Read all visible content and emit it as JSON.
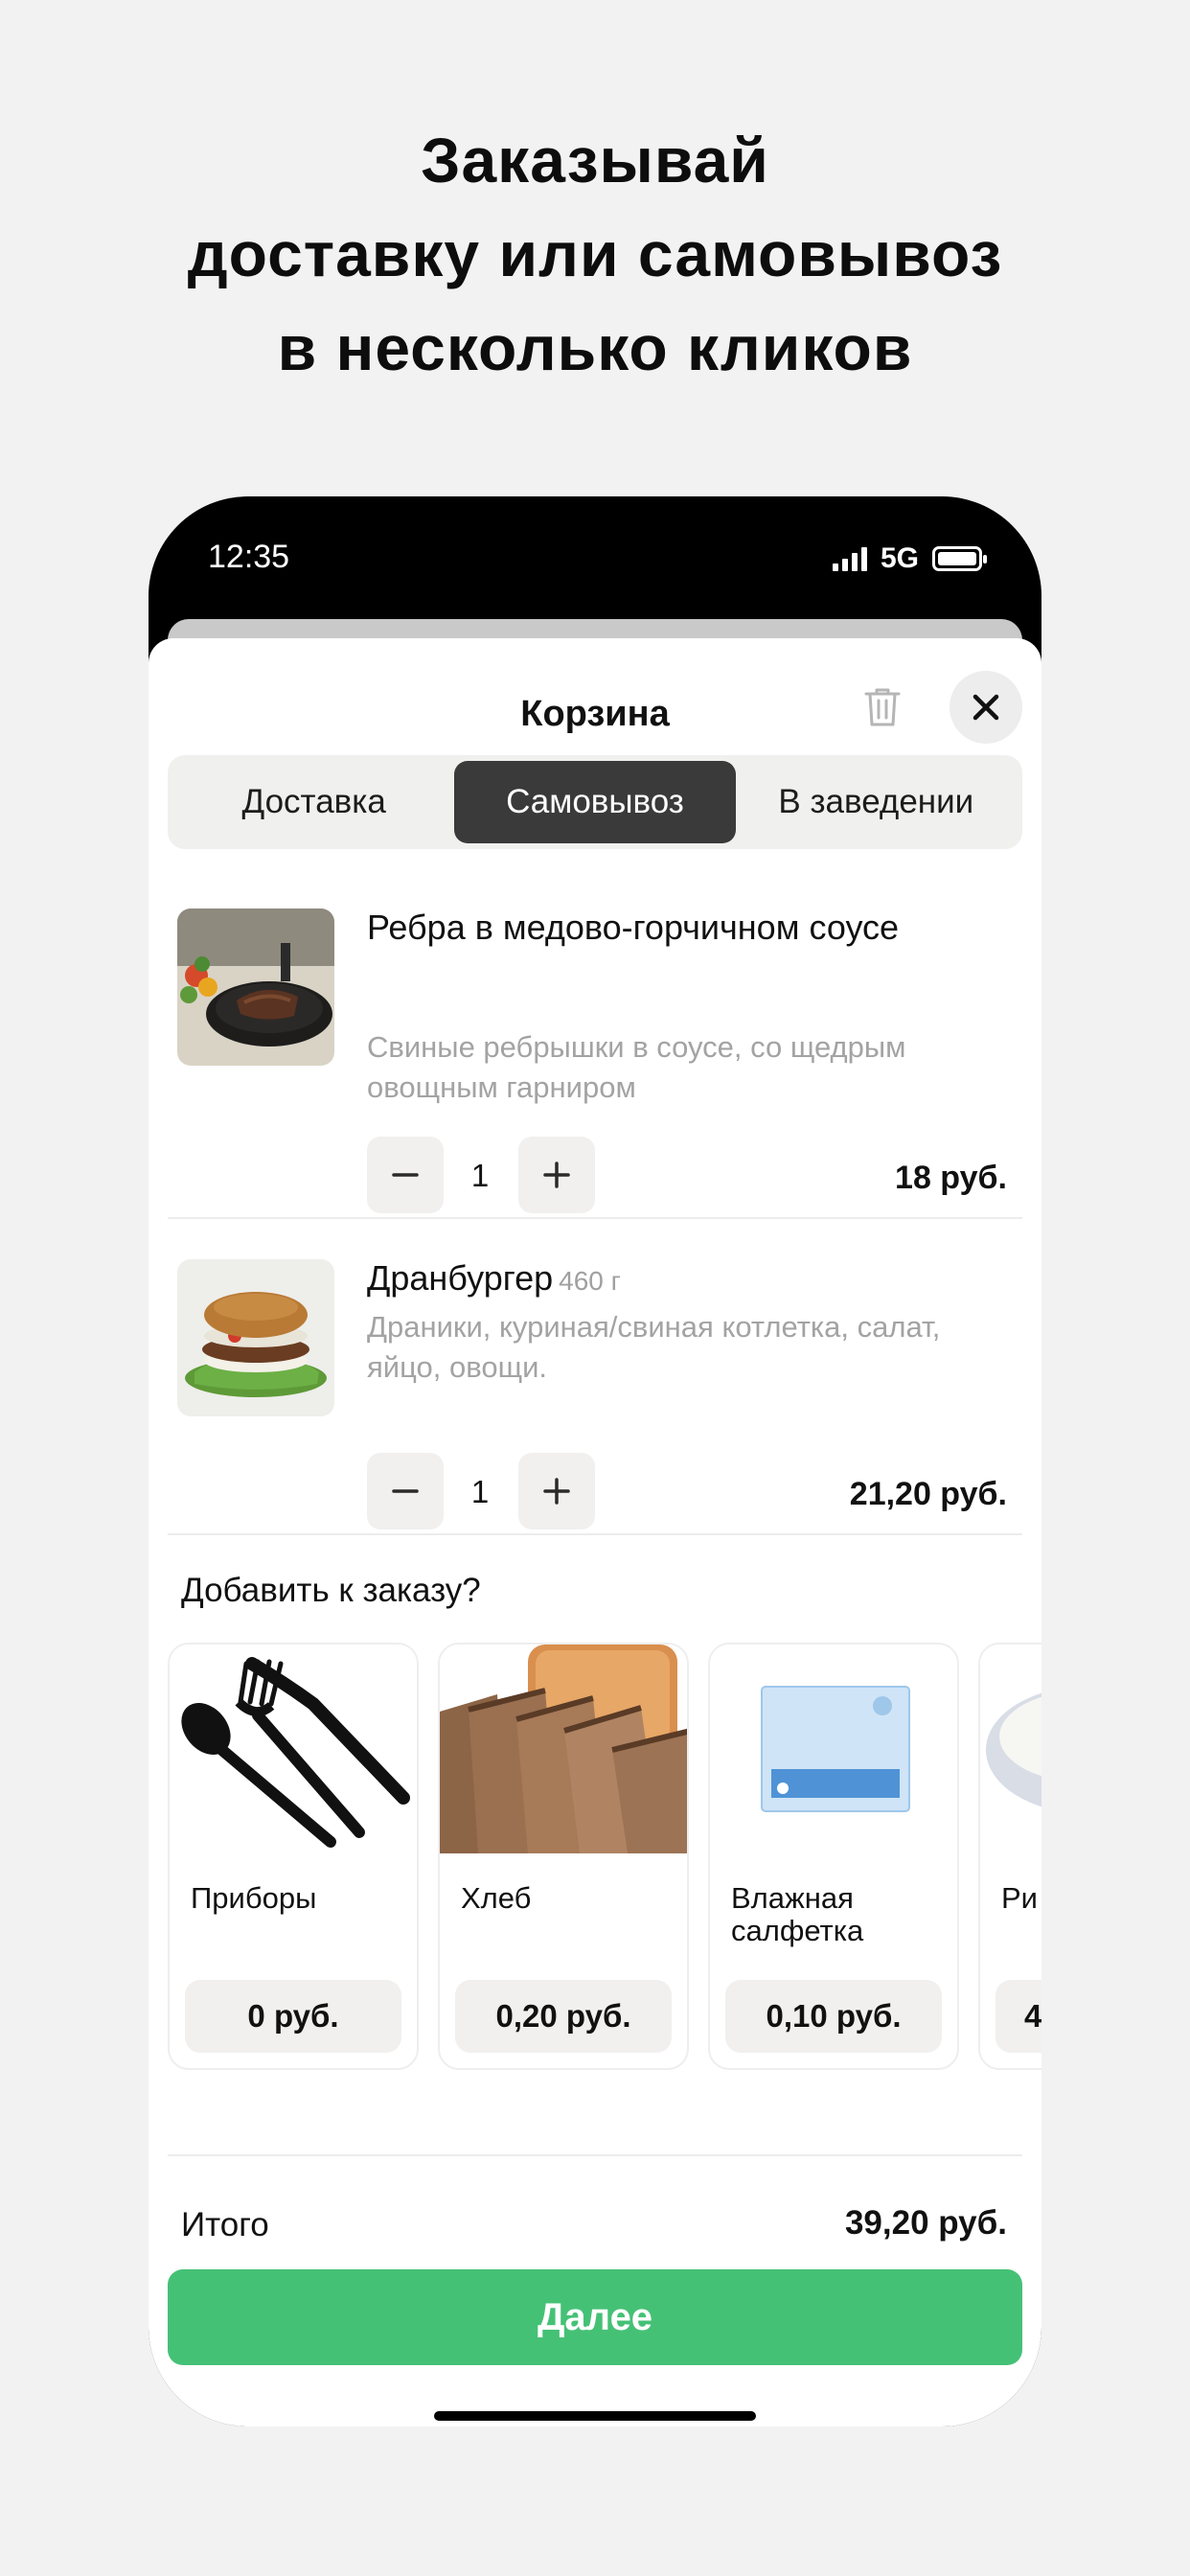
{
  "headline": {
    "line1": "Заказывай",
    "line2": "доставку или самовывоз",
    "line3": "в несколько кликов"
  },
  "status_bar": {
    "time": "12:35",
    "network": "5G"
  },
  "cart": {
    "title": "Корзина",
    "tabs": [
      {
        "label": "Доставка",
        "active": false
      },
      {
        "label": "Самовывоз",
        "active": true
      },
      {
        "label": "В заведении",
        "active": false
      }
    ],
    "items": [
      {
        "title": "Ребра в медово-горчичном соусе",
        "weight": "",
        "description": "Свиные ребрышки в соусе, со щедрым овощным гарниром",
        "quantity": "1",
        "price": "18 руб."
      },
      {
        "title": "Дранбургер",
        "weight": "460 г",
        "description": "Драники, куриная/свиная котлетка, салат, яйцо, овощи.",
        "quantity": "1",
        "price": "21,20 руб."
      }
    ],
    "addons_title": "Добавить к заказу?",
    "addons": [
      {
        "name": "Приборы",
        "price": "0 руб."
      },
      {
        "name": "Хлеб",
        "price": "0,20 руб."
      },
      {
        "name": "Влажная салфетка",
        "price": "0,10 руб."
      },
      {
        "name": "Ри",
        "price": "4"
      }
    ],
    "total_label": "Итого",
    "total_value": "39,20 руб.",
    "next_label": "Далее"
  },
  "colors": {
    "accent": "#45c176",
    "segment_active": "#3a3a3a"
  },
  "icons": [
    "trash-icon",
    "close-icon",
    "minus-icon",
    "plus-icon",
    "signal-icon",
    "battery-icon"
  ]
}
